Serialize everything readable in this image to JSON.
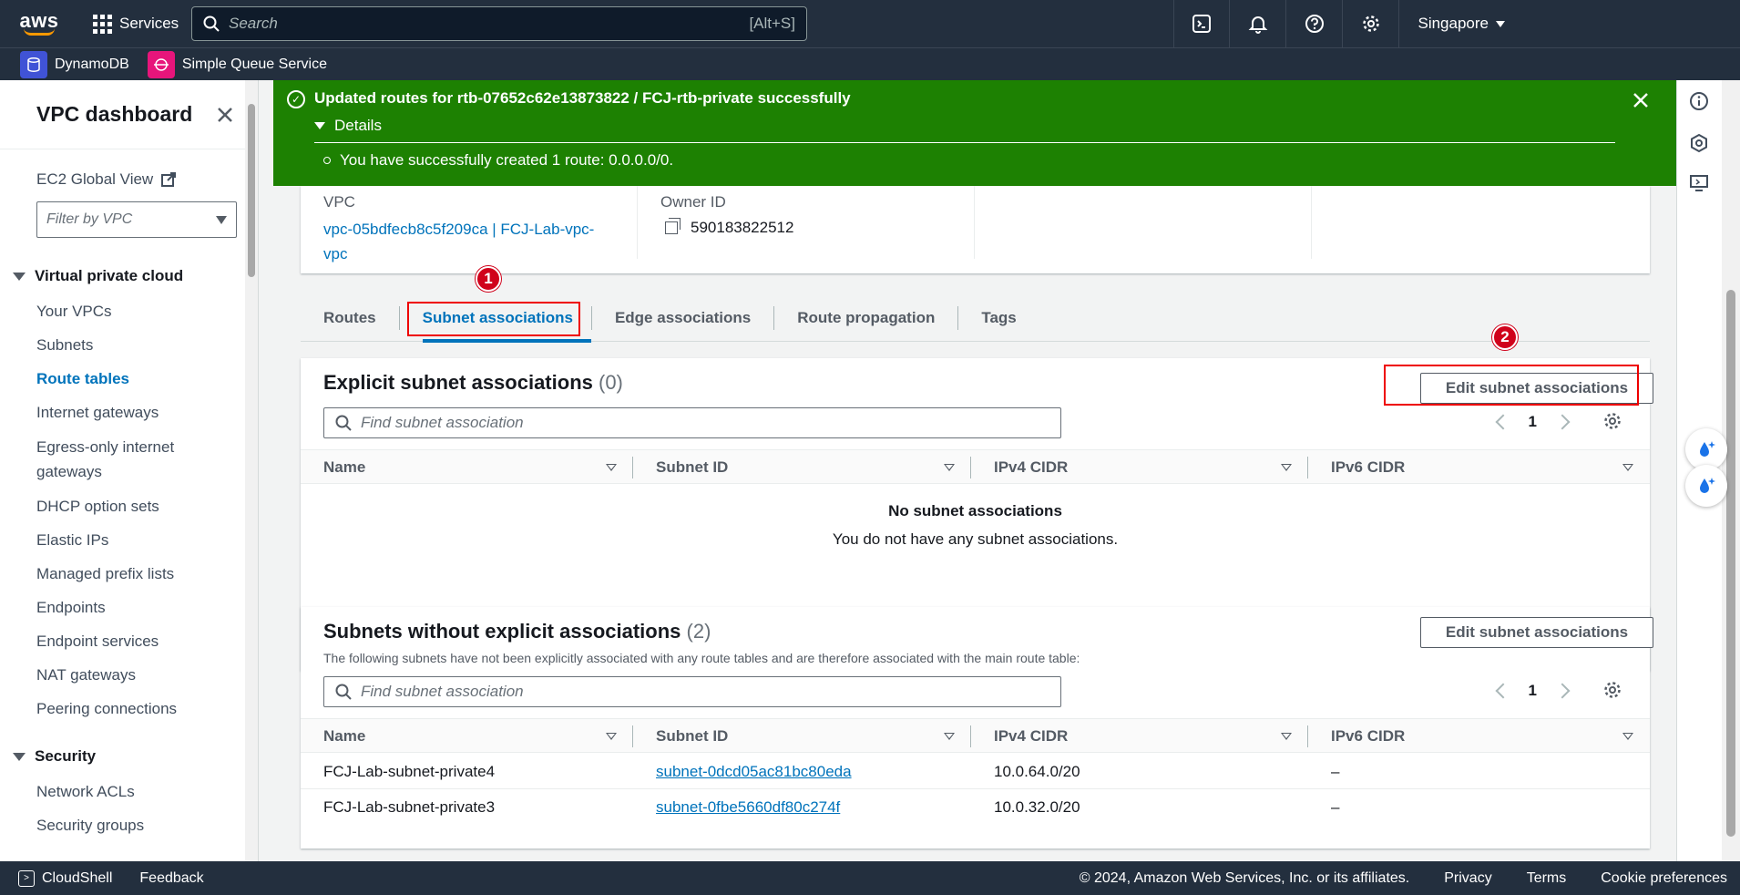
{
  "topnav": {
    "logo": "aws",
    "services_label": "Services",
    "search_placeholder": "Search",
    "search_shortcut": "[Alt+S]",
    "region": "Singapore"
  },
  "favorites": [
    {
      "label": "DynamoDB",
      "color": "#4053d6"
    },
    {
      "label": "Simple Queue Service",
      "color": "#e7157b"
    }
  ],
  "sidebar": {
    "title": "VPC dashboard",
    "ec2_global_view": "EC2 Global View",
    "filter_placeholder": "Filter by VPC",
    "section_vpc": "Virtual private cloud",
    "items": [
      "Your VPCs",
      "Subnets",
      "Route tables",
      "Internet gateways",
      "Egress-only internet gateways",
      "DHCP option sets",
      "Elastic IPs",
      "Managed prefix lists",
      "Endpoints",
      "Endpoint services",
      "NAT gateways",
      "Peering connections"
    ],
    "active_item": "Route tables",
    "section_security": "Security",
    "security_items": [
      "Network ACLs",
      "Security groups"
    ]
  },
  "flash": {
    "message": "Updated routes for rtb-07652c62e13873822 / FCJ-rtb-private successfully",
    "details_label": "Details",
    "detail_item": "You have successfully created 1 route: 0.0.0.0/0.",
    "color": "#1d8102"
  },
  "details": {
    "vpc_label": "VPC",
    "vpc_value": "vpc-05bdfecb8c5f209ca | FCJ-Lab-vpc-vpc",
    "owner_label": "Owner ID",
    "owner_value": "590183822512"
  },
  "tabs": [
    "Routes",
    "Subnet associations",
    "Edge associations",
    "Route propagation",
    "Tags"
  ],
  "active_tab": "Subnet associations",
  "annotations": {
    "badge1": "1",
    "badge2": "2"
  },
  "explicit": {
    "title": "Explicit subnet associations",
    "count": "(0)",
    "edit_button": "Edit subnet associations",
    "find_placeholder": "Find subnet association",
    "page": "1",
    "columns": [
      "Name",
      "Subnet ID",
      "IPv4 CIDR",
      "IPv6 CIDR"
    ],
    "empty_title": "No subnet associations",
    "empty_desc": "You do not have any subnet associations."
  },
  "implicit": {
    "title": "Subnets without explicit associations",
    "count": "(2)",
    "description": "The following subnets have not been explicitly associated with any route tables and are therefore associated with the main route table:",
    "edit_button": "Edit subnet associations",
    "find_placeholder": "Find subnet association",
    "page": "1",
    "columns": [
      "Name",
      "Subnet ID",
      "IPv4 CIDR",
      "IPv6 CIDR"
    ],
    "rows": [
      {
        "name": "FCJ-Lab-subnet-private4",
        "subnet_id": "subnet-0dcd05ac81bc80eda",
        "ipv4": "10.0.64.0/20",
        "ipv6": "–"
      },
      {
        "name": "FCJ-Lab-subnet-private3",
        "subnet_id": "subnet-0fbe5660df80c274f",
        "ipv4": "10.0.32.0/20",
        "ipv6": "–"
      }
    ]
  },
  "footer": {
    "cloudshell": "CloudShell",
    "feedback": "Feedback",
    "copyright": "© 2024, Amazon Web Services, Inc. or its affiliates.",
    "privacy": "Privacy",
    "terms": "Terms",
    "cookies": "Cookie preferences"
  }
}
